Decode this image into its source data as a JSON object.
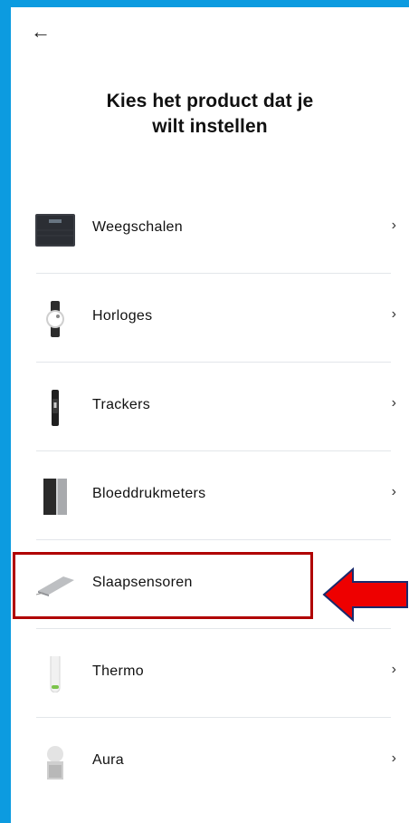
{
  "header": {
    "back_icon": "arrow-left-icon",
    "title": "Kies het product   dat je\nwilt instellen"
  },
  "products": [
    {
      "label": "Weegschalen",
      "icon": "scale-icon",
      "chevron": "›"
    },
    {
      "label": "Horloges",
      "icon": "watch-icon",
      "chevron": "›"
    },
    {
      "label": "Trackers",
      "icon": "tracker-icon",
      "chevron": "›"
    },
    {
      "label": "Bloeddrukmeters",
      "icon": "blood-pressure-monitor-icon",
      "chevron": "›"
    },
    {
      "label": "Slaapsensoren",
      "icon": "sleep-sensor-icon",
      "chevron": ""
    },
    {
      "label": "Thermo",
      "icon": "thermometer-icon",
      "chevron": "›"
    },
    {
      "label": "Aura",
      "icon": "aura-lamp-icon",
      "chevron": "›"
    }
  ],
  "annotation": {
    "highlight_color": "#b00000",
    "arrow_color": "#ee0000",
    "arrow_outline_color": "#1a2a6c"
  }
}
